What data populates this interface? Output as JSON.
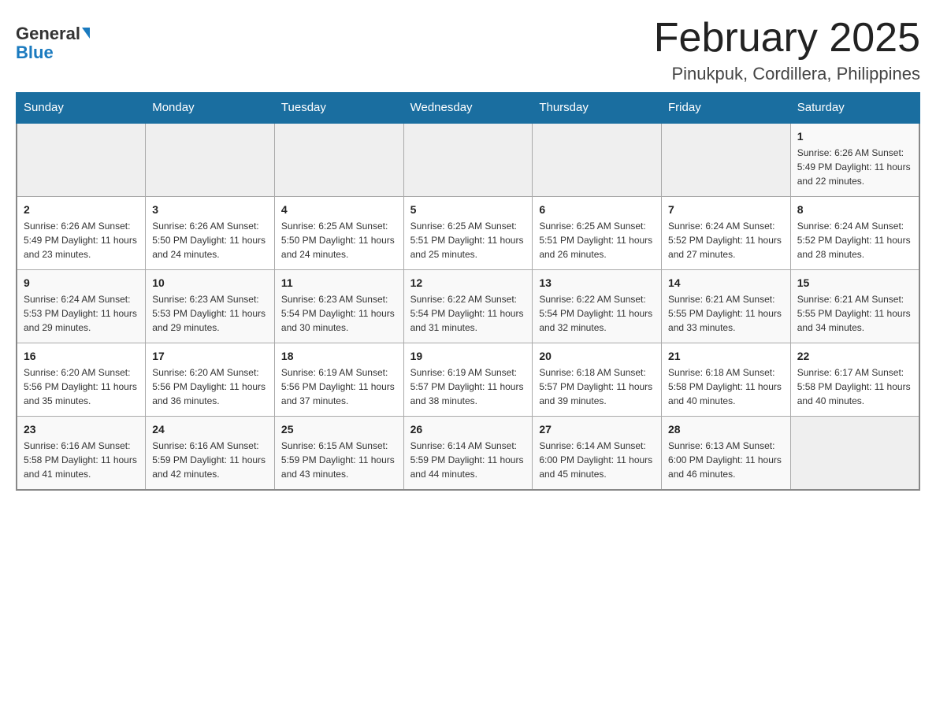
{
  "logo": {
    "general": "General",
    "blue": "Blue"
  },
  "header": {
    "title": "February 2025",
    "subtitle": "Pinukpuk, Cordillera, Philippines"
  },
  "days_of_week": [
    "Sunday",
    "Monday",
    "Tuesday",
    "Wednesday",
    "Thursday",
    "Friday",
    "Saturday"
  ],
  "weeks": [
    {
      "days": [
        {
          "number": "",
          "info": "",
          "empty": true
        },
        {
          "number": "",
          "info": "",
          "empty": true
        },
        {
          "number": "",
          "info": "",
          "empty": true
        },
        {
          "number": "",
          "info": "",
          "empty": true
        },
        {
          "number": "",
          "info": "",
          "empty": true
        },
        {
          "number": "",
          "info": "",
          "empty": true
        },
        {
          "number": "1",
          "info": "Sunrise: 6:26 AM\nSunset: 5:49 PM\nDaylight: 11 hours\nand 22 minutes."
        }
      ]
    },
    {
      "days": [
        {
          "number": "2",
          "info": "Sunrise: 6:26 AM\nSunset: 5:49 PM\nDaylight: 11 hours\nand 23 minutes."
        },
        {
          "number": "3",
          "info": "Sunrise: 6:26 AM\nSunset: 5:50 PM\nDaylight: 11 hours\nand 24 minutes."
        },
        {
          "number": "4",
          "info": "Sunrise: 6:25 AM\nSunset: 5:50 PM\nDaylight: 11 hours\nand 24 minutes."
        },
        {
          "number": "5",
          "info": "Sunrise: 6:25 AM\nSunset: 5:51 PM\nDaylight: 11 hours\nand 25 minutes."
        },
        {
          "number": "6",
          "info": "Sunrise: 6:25 AM\nSunset: 5:51 PM\nDaylight: 11 hours\nand 26 minutes."
        },
        {
          "number": "7",
          "info": "Sunrise: 6:24 AM\nSunset: 5:52 PM\nDaylight: 11 hours\nand 27 minutes."
        },
        {
          "number": "8",
          "info": "Sunrise: 6:24 AM\nSunset: 5:52 PM\nDaylight: 11 hours\nand 28 minutes."
        }
      ]
    },
    {
      "days": [
        {
          "number": "9",
          "info": "Sunrise: 6:24 AM\nSunset: 5:53 PM\nDaylight: 11 hours\nand 29 minutes."
        },
        {
          "number": "10",
          "info": "Sunrise: 6:23 AM\nSunset: 5:53 PM\nDaylight: 11 hours\nand 29 minutes."
        },
        {
          "number": "11",
          "info": "Sunrise: 6:23 AM\nSunset: 5:54 PM\nDaylight: 11 hours\nand 30 minutes."
        },
        {
          "number": "12",
          "info": "Sunrise: 6:22 AM\nSunset: 5:54 PM\nDaylight: 11 hours\nand 31 minutes."
        },
        {
          "number": "13",
          "info": "Sunrise: 6:22 AM\nSunset: 5:54 PM\nDaylight: 11 hours\nand 32 minutes."
        },
        {
          "number": "14",
          "info": "Sunrise: 6:21 AM\nSunset: 5:55 PM\nDaylight: 11 hours\nand 33 minutes."
        },
        {
          "number": "15",
          "info": "Sunrise: 6:21 AM\nSunset: 5:55 PM\nDaylight: 11 hours\nand 34 minutes."
        }
      ]
    },
    {
      "days": [
        {
          "number": "16",
          "info": "Sunrise: 6:20 AM\nSunset: 5:56 PM\nDaylight: 11 hours\nand 35 minutes."
        },
        {
          "number": "17",
          "info": "Sunrise: 6:20 AM\nSunset: 5:56 PM\nDaylight: 11 hours\nand 36 minutes."
        },
        {
          "number": "18",
          "info": "Sunrise: 6:19 AM\nSunset: 5:56 PM\nDaylight: 11 hours\nand 37 minutes."
        },
        {
          "number": "19",
          "info": "Sunrise: 6:19 AM\nSunset: 5:57 PM\nDaylight: 11 hours\nand 38 minutes."
        },
        {
          "number": "20",
          "info": "Sunrise: 6:18 AM\nSunset: 5:57 PM\nDaylight: 11 hours\nand 39 minutes."
        },
        {
          "number": "21",
          "info": "Sunrise: 6:18 AM\nSunset: 5:58 PM\nDaylight: 11 hours\nand 40 minutes."
        },
        {
          "number": "22",
          "info": "Sunrise: 6:17 AM\nSunset: 5:58 PM\nDaylight: 11 hours\nand 40 minutes."
        }
      ]
    },
    {
      "days": [
        {
          "number": "23",
          "info": "Sunrise: 6:16 AM\nSunset: 5:58 PM\nDaylight: 11 hours\nand 41 minutes."
        },
        {
          "number": "24",
          "info": "Sunrise: 6:16 AM\nSunset: 5:59 PM\nDaylight: 11 hours\nand 42 minutes."
        },
        {
          "number": "25",
          "info": "Sunrise: 6:15 AM\nSunset: 5:59 PM\nDaylight: 11 hours\nand 43 minutes."
        },
        {
          "number": "26",
          "info": "Sunrise: 6:14 AM\nSunset: 5:59 PM\nDaylight: 11 hours\nand 44 minutes."
        },
        {
          "number": "27",
          "info": "Sunrise: 6:14 AM\nSunset: 6:00 PM\nDaylight: 11 hours\nand 45 minutes."
        },
        {
          "number": "28",
          "info": "Sunrise: 6:13 AM\nSunset: 6:00 PM\nDaylight: 11 hours\nand 46 minutes."
        },
        {
          "number": "",
          "info": "",
          "empty": true
        }
      ]
    }
  ]
}
